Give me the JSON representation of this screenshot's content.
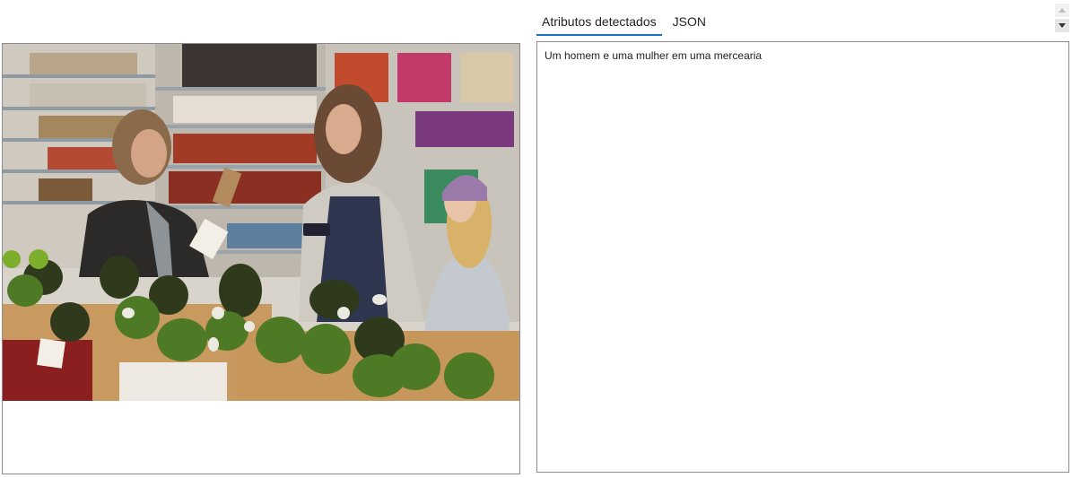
{
  "tabs": [
    {
      "label": "Atributos detectados",
      "active": true
    },
    {
      "label": "JSON",
      "active": false
    }
  ],
  "result": {
    "caption": "Um homem e uma mulher em uma mercearia"
  },
  "colors": {
    "tab_accent": "#1a73c9",
    "panel_border": "#8a8a8a"
  },
  "icons": {
    "scroll_up": "caret-up-icon",
    "scroll_down": "caret-down-icon"
  }
}
